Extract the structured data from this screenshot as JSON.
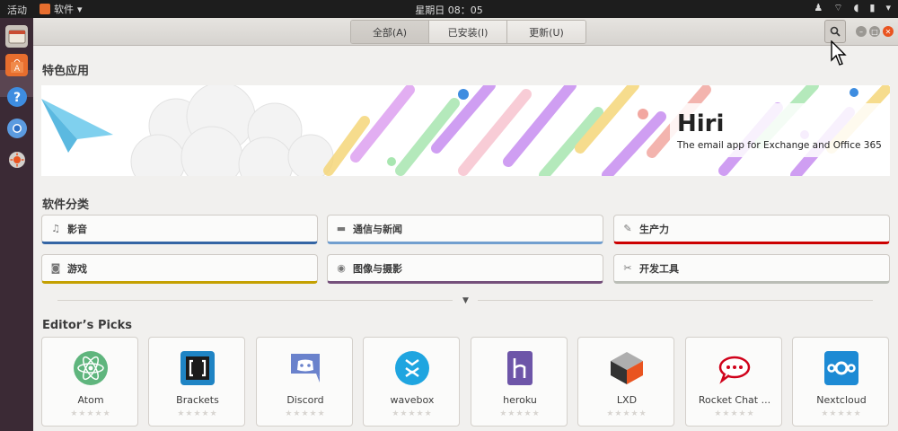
{
  "top_panel": {
    "activities": "活动",
    "app_name": "软件",
    "clock": "星期日 08：05"
  },
  "header": {
    "tabs": [
      {
        "label": "全部(A)"
      },
      {
        "label": "已安装(I)"
      },
      {
        "label": "更新(U)"
      }
    ]
  },
  "featured": {
    "section_title": "特色应用",
    "app_title": "Hiri",
    "app_subtitle": "The email app for Exchange and Office 365"
  },
  "categories": {
    "section_title": "软件分类",
    "items": [
      {
        "label": "影音",
        "icon": "music-note-icon",
        "accent": "#3465a4"
      },
      {
        "label": "通信与新闻",
        "icon": "chat-icon",
        "accent": "#729fcf"
      },
      {
        "label": "生产力",
        "icon": "edit-icon",
        "accent": "#cc0000"
      },
      {
        "label": "游戏",
        "icon": "gamepad-icon",
        "accent": "#c4a000"
      },
      {
        "label": "图像与摄影",
        "icon": "camera-icon",
        "accent": "#75507b"
      },
      {
        "label": "开发工具",
        "icon": "tools-icon",
        "accent": "#babdb6"
      }
    ]
  },
  "editors_picks": {
    "section_title": "Editor’s Picks",
    "apps": [
      {
        "name": "Atom"
      },
      {
        "name": "Brackets"
      },
      {
        "name": "Discord"
      },
      {
        "name": "wavebox"
      },
      {
        "name": "heroku"
      },
      {
        "name": "LXD"
      },
      {
        "name": "Rocket Chat ..."
      },
      {
        "name": "Nextcloud"
      }
    ]
  },
  "colors": {
    "dock_bg": "#3b2a35",
    "panel_bg": "#1d1d1d",
    "close_button": "#e95420"
  }
}
